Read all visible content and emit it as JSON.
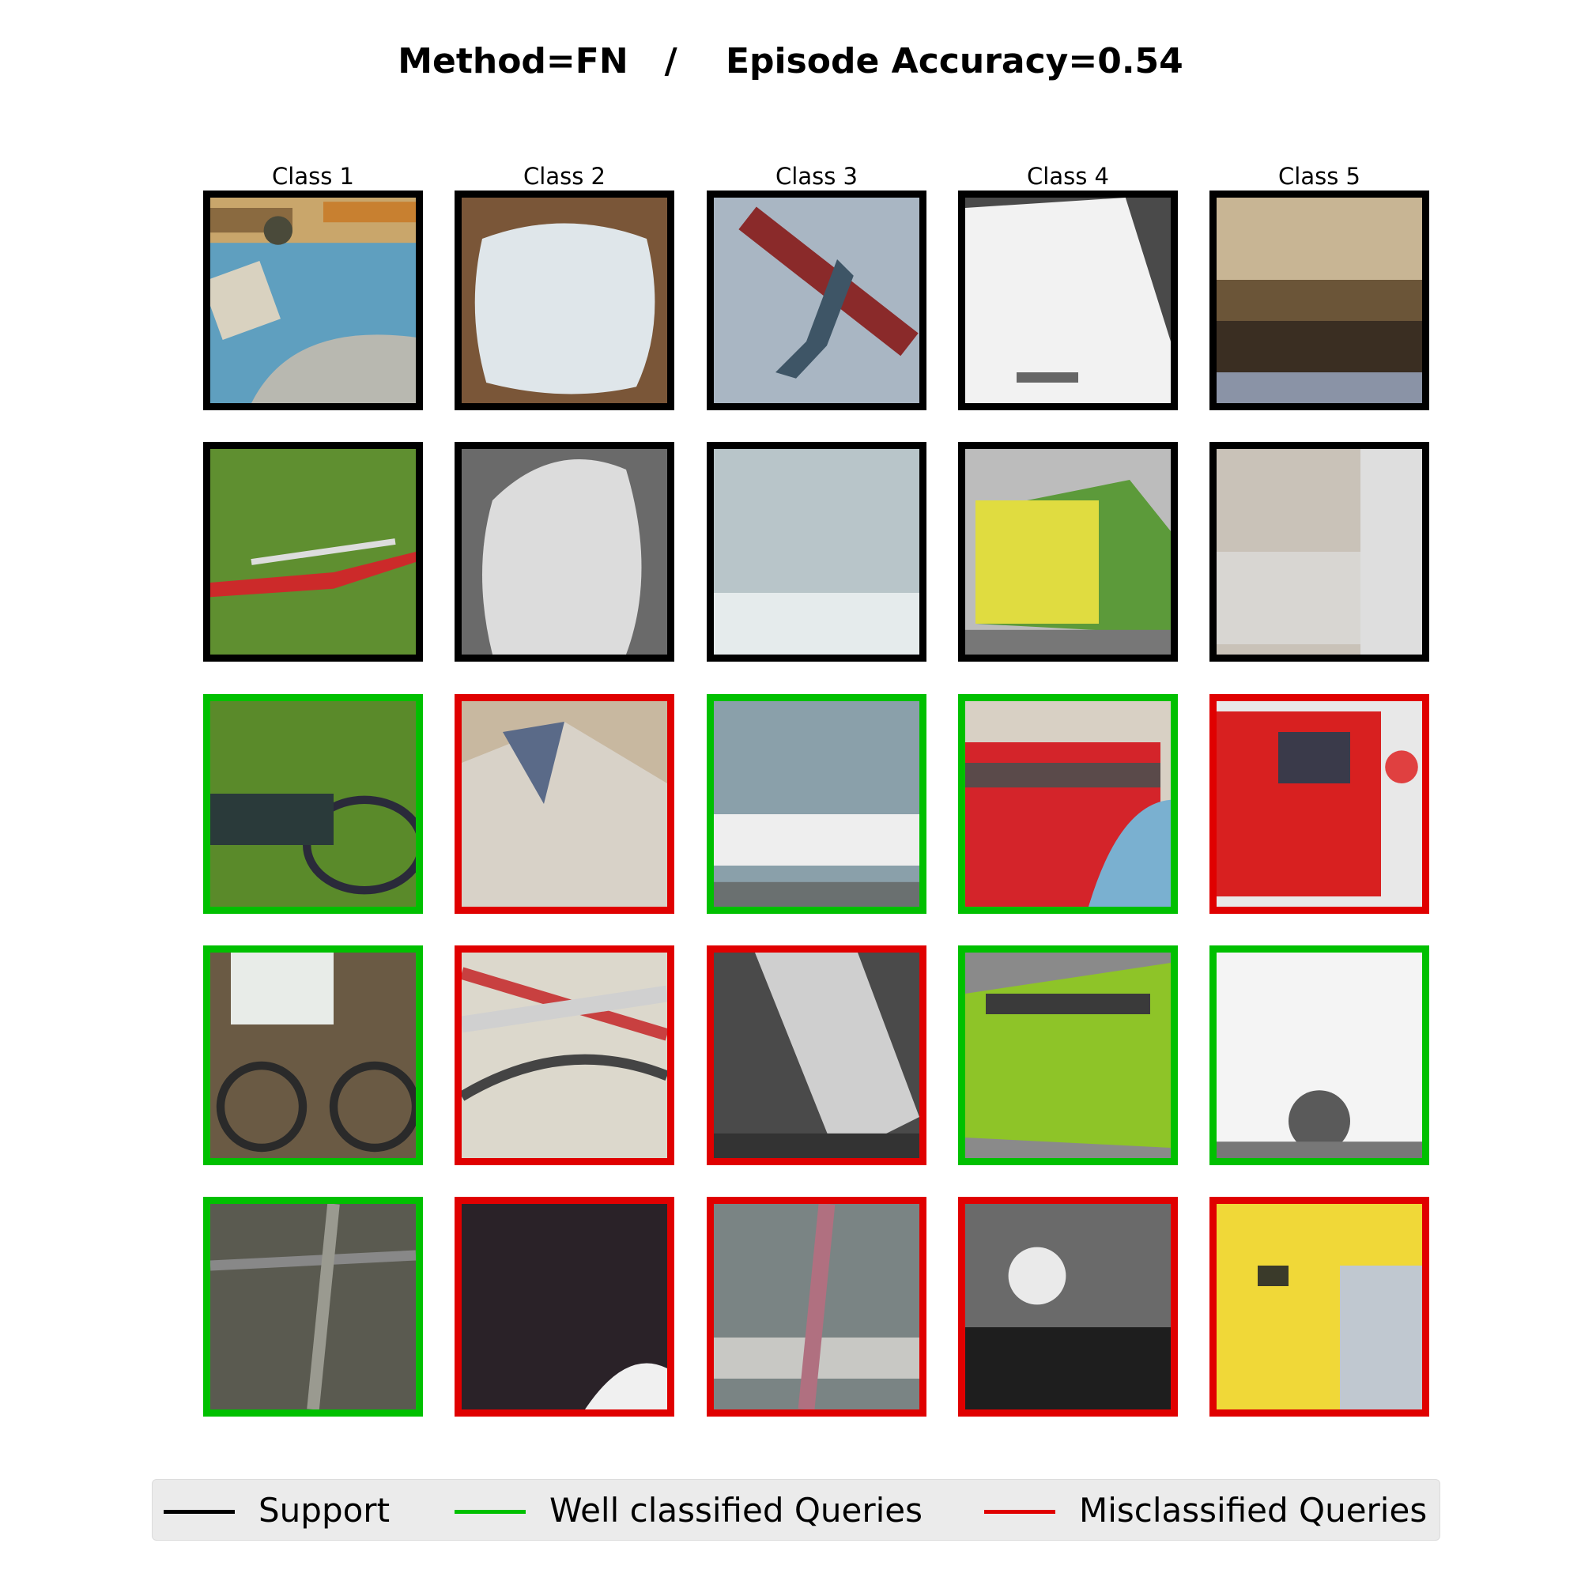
{
  "title": "Method=FN   /    Episode Accuracy=0.54",
  "colors": {
    "support": "#000000",
    "well": "#00c000",
    "mis": "#e00000"
  },
  "columns": [
    "Class 1",
    "Class 2",
    "Class 3",
    "Class 4",
    "Class 5"
  ],
  "rows": [
    [
      "support",
      "support",
      "support",
      "support",
      "support"
    ],
    [
      "support",
      "support",
      "support",
      "support",
      "support"
    ],
    [
      "well",
      "mis",
      "well",
      "well",
      "mis"
    ],
    [
      "well",
      "mis",
      "mis",
      "well",
      "well"
    ],
    [
      "well",
      "mis",
      "mis",
      "mis",
      "mis"
    ]
  ],
  "legend": {
    "support": "Support",
    "well": "Well classified Queries",
    "mis": "Misclassified Queries"
  }
}
